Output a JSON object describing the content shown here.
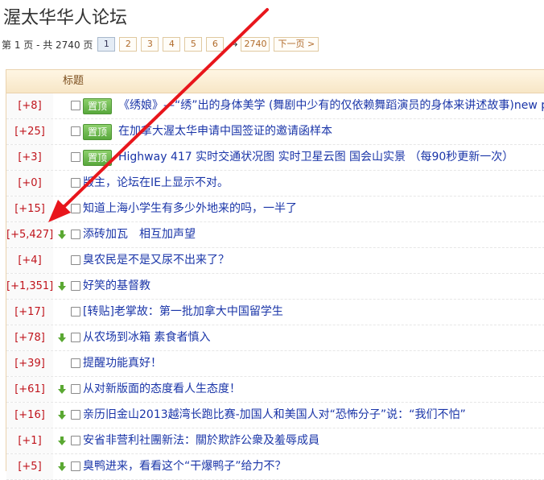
{
  "page": {
    "title": "渥太华华人论坛"
  },
  "pager": {
    "info": "第 1 页 - 共 2740 页",
    "pages": [
      "1",
      "2",
      "3",
      "4",
      "5",
      "6"
    ],
    "current": "1",
    "arrow": "→",
    "last": "2740",
    "next": "下一页 >"
  },
  "table": {
    "header": "标题",
    "tag_label": "置顶",
    "rows": [
      {
        "score": "[+8]",
        "title": "《绣娘》—“绣”出的身体美学 (舞剧中少有的仅依赖舞蹈演员的身体来讲述故事)new ph",
        "pinned": true,
        "down": false
      },
      {
        "score": "[+25]",
        "title": "在加拿大渥太华申请中国签证的邀请函样本",
        "pinned": true,
        "down": false
      },
      {
        "score": "[+3]",
        "title": "Highway 417 实时交通状况图 实时卫星云图 国会山实景 （每90秒更新一次）",
        "pinned": true,
        "down": false
      },
      {
        "score": "[+0]",
        "title": "版主，论坛在IE上显示不对。",
        "pinned": false,
        "down": false
      },
      {
        "score": "[+15]",
        "title": "知道上海小学生有多少外地来的吗，一半了",
        "pinned": false,
        "down": true
      },
      {
        "score": "[+5,427]",
        "title": "添砖加瓦　相互加声望",
        "pinned": false,
        "down": true
      },
      {
        "score": "[+4]",
        "title": "臭农民是不是又尿不出来了？",
        "pinned": false,
        "down": false
      },
      {
        "score": "[+1,351]",
        "title": "好笑的基督教",
        "pinned": false,
        "down": true
      },
      {
        "score": "[+17]",
        "title": "[转贴]老掌故：第一批加拿大中国留学生",
        "pinned": false,
        "down": false
      },
      {
        "score": "[+78]",
        "title": "从农场到冰箱 素食者慎入",
        "pinned": false,
        "down": true
      },
      {
        "score": "[+39]",
        "title": "提醒功能真好！",
        "pinned": false,
        "down": false
      },
      {
        "score": "[+61]",
        "title": "从对新版面的态度看人生态度！",
        "pinned": false,
        "down": true
      },
      {
        "score": "[+16]",
        "title": "亲历旧金山2013越湾长跑比赛-加国人和美国人对“恐怖分子”说：“我们不怕”",
        "pinned": false,
        "down": true
      },
      {
        "score": "[+1]",
        "title": "安省非营利社團新法：關於欺詐公衆及羞辱成員",
        "pinned": false,
        "down": true
      },
      {
        "score": "[+5]",
        "title": "臭鸭进来，看看这个“干爆鸭子”给力不？",
        "pinned": false,
        "down": true
      }
    ]
  },
  "colors": {
    "score": "#c0141c",
    "link": "#1a35a8",
    "annotation_arrow": "#e8161c",
    "tag": "#58a83c",
    "down_arrow": "#5aa832"
  },
  "icons": {
    "down": "green-down-arrow-icon",
    "checkbox": "checkbox-icon"
  }
}
